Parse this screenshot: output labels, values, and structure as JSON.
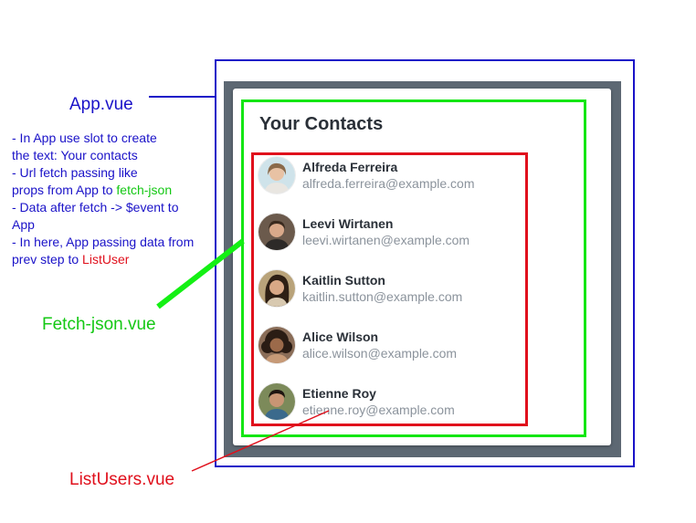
{
  "labels": {
    "app": "App.vue",
    "fetch_json": "Fetch-json.vue",
    "list_users": "ListUsers.vue"
  },
  "notes": {
    "line1": "- In App use slot to create",
    "line2": "the text: Your contacts",
    "line3": "- Url fetch passing like",
    "line4_prefix": "props from App to ",
    "line4_highlight": "fetch-json",
    "line5": "- Data after fetch -> $event to",
    "line6": "App",
    "line7": "- In here, App passing data from",
    "line8_prefix": "prev step to ",
    "line8_highlight": "ListUser"
  },
  "card": {
    "title": "Your Contacts",
    "contacts": [
      {
        "name": "Alfreda Ferreira",
        "email": "alfreda.ferreira@example.com"
      },
      {
        "name": "Leevi Wirtanen",
        "email": "leevi.wirtanen@example.com"
      },
      {
        "name": "Kaitlin Sutton",
        "email": "kaitlin.sutton@example.com"
      },
      {
        "name": "Alice Wilson",
        "email": "alice.wilson@example.com"
      },
      {
        "name": "Etienne Roy",
        "email": "etienne.roy@example.com"
      }
    ]
  },
  "colors": {
    "app_outline": "#1a12c8",
    "fetch_outline": "#14e614",
    "list_outline": "#e0101c",
    "panel": "#5d6873"
  }
}
